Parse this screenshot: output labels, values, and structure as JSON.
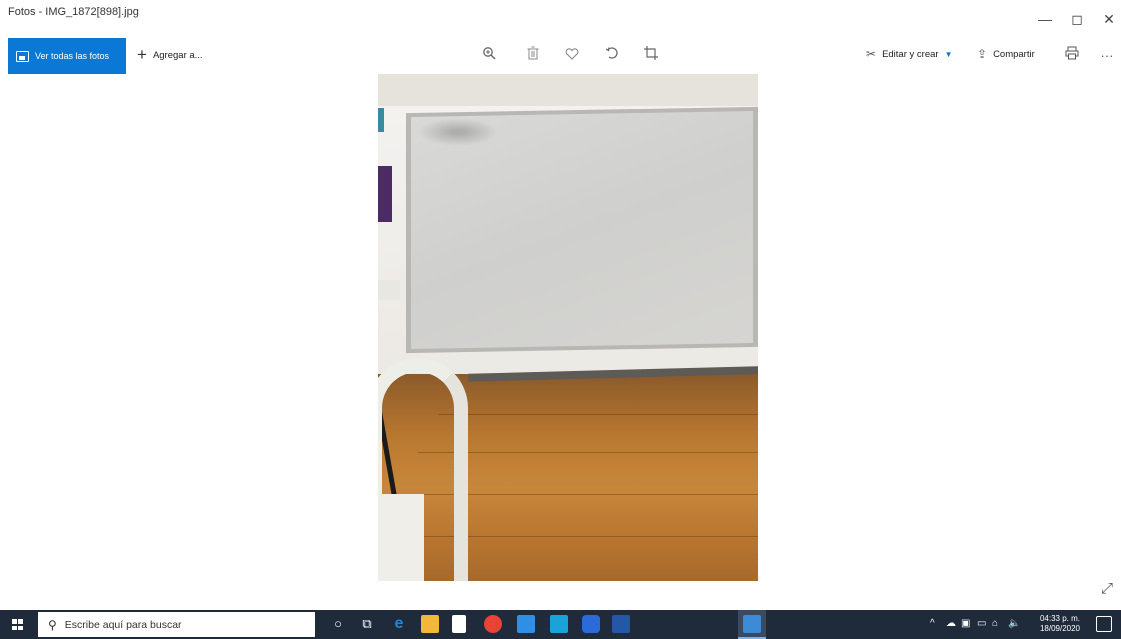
{
  "window": {
    "title": "Fotos - IMG_1872[898].jpg",
    "minimize_glyph": "—",
    "maximize_glyph": "◻",
    "close_glyph": "✕"
  },
  "toolbar": {
    "view_all_label": "Ver todas las fotos",
    "add_to_label": "Agregar a...",
    "edit_create_label": "Editar y crear",
    "share_label": "Compartir",
    "more_glyph": "···",
    "icons": [
      "zoom-icon",
      "delete-icon",
      "favorite-icon",
      "rotate-icon",
      "crop-icon",
      "print-icon"
    ]
  },
  "taskbar": {
    "search_placeholder": "Escribe aquí para buscar",
    "time": "04:33 p. m.",
    "date": "18/09/2020",
    "colors": {
      "background": "#1f2a3a",
      "edge": "#1e86d8",
      "explorer": "#f3b73b",
      "store": "#ffffff",
      "chrome": "#e84335",
      "mail": "#2d8fe6",
      "app_teal": "#1aa3d8",
      "app_blue": "#2b6bd8",
      "photos": "#3d8ad6"
    }
  },
  "colors": {
    "accent": "#0a78d4"
  }
}
